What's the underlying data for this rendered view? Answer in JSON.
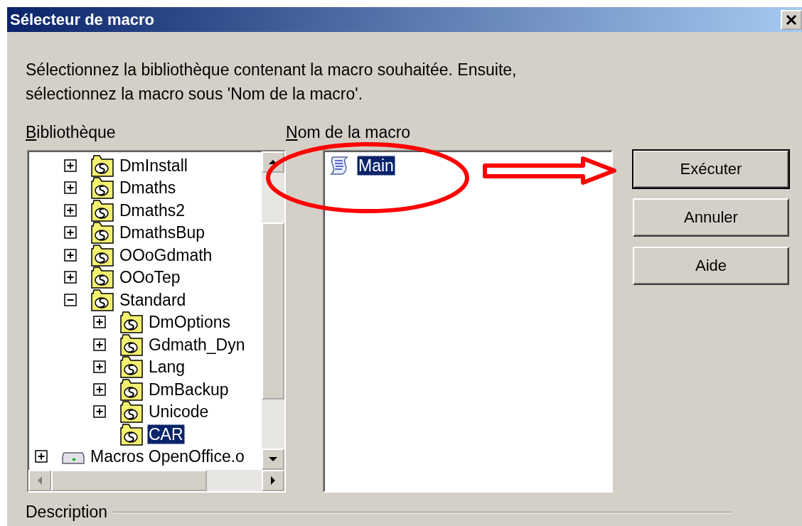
{
  "window": {
    "title": "Sélecteur de macro"
  },
  "instructions": "Sélectionnez la bibliothèque contenant la macro souhaitée. Ensuite,\nsélectionnez la macro sous 'Nom de la macro'.",
  "library": {
    "label": "Bibliothèque",
    "tree": [
      {
        "children": [
          {
            "label": "DmInstall",
            "kind": "library",
            "expanded": false,
            "selected": false
          },
          {
            "label": "Dmaths",
            "kind": "library",
            "expanded": false,
            "selected": false
          },
          {
            "label": "Dmaths2",
            "kind": "library",
            "expanded": false,
            "selected": false
          },
          {
            "label": "DmathsBup",
            "kind": "library",
            "expanded": false,
            "selected": false
          },
          {
            "label": "OOoGdmath",
            "kind": "library",
            "expanded": false,
            "selected": false
          },
          {
            "label": "OOoTep",
            "kind": "library",
            "expanded": false,
            "selected": false
          },
          {
            "label": "Standard",
            "kind": "library",
            "expanded": true,
            "selected": false,
            "children": [
              {
                "label": "DmOptions",
                "kind": "library",
                "expanded": false,
                "selected": false
              },
              {
                "label": "Gdmath_Dyn",
                "kind": "library",
                "expanded": false,
                "selected": false
              },
              {
                "label": "Lang",
                "kind": "library",
                "expanded": false,
                "selected": false
              },
              {
                "label": "DmBackup",
                "kind": "library",
                "expanded": false,
                "selected": false
              },
              {
                "label": "Unicode",
                "kind": "library",
                "expanded": false,
                "selected": false
              },
              {
                "label": "CAR",
                "kind": "library",
                "selected": true
              }
            ]
          }
        ]
      },
      {
        "label": "Macros OpenOffice.o",
        "kind": "drive",
        "expanded": false,
        "selected": false
      }
    ]
  },
  "macro_list": {
    "label": "Nom de la macro",
    "items": [
      {
        "label": "Main",
        "selected": true
      }
    ]
  },
  "buttons": [
    {
      "label": "Exécuter",
      "default": true
    },
    {
      "label": "Annuler",
      "default": false
    },
    {
      "label": "Aide",
      "default": false
    }
  ],
  "description": {
    "label": "Description"
  }
}
